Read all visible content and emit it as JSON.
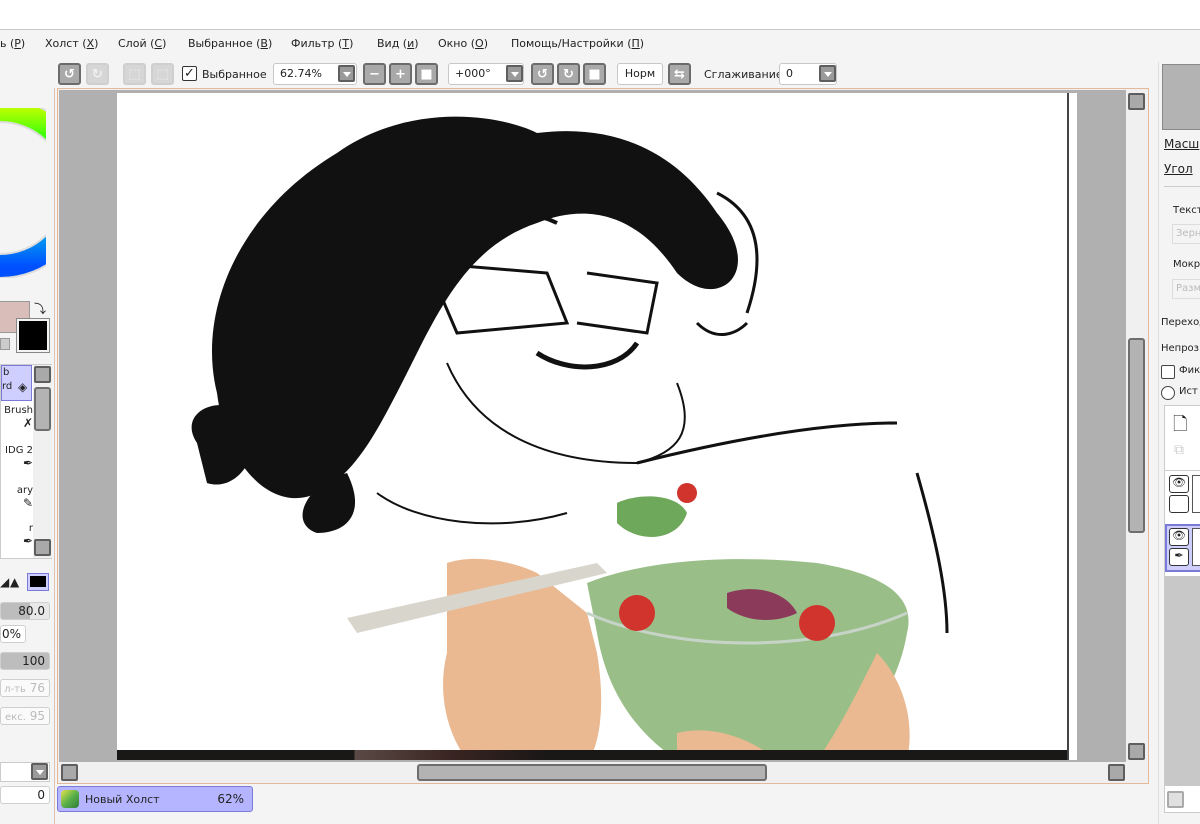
{
  "menu": [
    {
      "label": "ь",
      "key": "Р"
    },
    {
      "label": "Холст",
      "key": "Х"
    },
    {
      "label": "Слой",
      "key": "С"
    },
    {
      "label": "Выбранное",
      "key": "В"
    },
    {
      "label": "Фильтр",
      "key": "Т"
    },
    {
      "label": "Вид",
      "key": "и"
    },
    {
      "label": "Окно",
      "key": "О"
    },
    {
      "label": "Помощь/Настройки",
      "key": "П"
    }
  ],
  "toolbar": {
    "selection_label": "Выбранное",
    "selection_checked": true,
    "zoom_value": "62.74%",
    "rotation_value": "+000°",
    "blend_mode": "Норм",
    "smoothing_label": "Сглаживание",
    "smoothing_value": "0"
  },
  "left_panel": {
    "brushes": [
      {
        "line1": "b",
        "line2": "rd"
      },
      {
        "line1": "Brush",
        "line2": ""
      },
      {
        "line1": "IDG 2",
        "line2": ""
      },
      {
        "line1": "ary",
        "line2": ""
      },
      {
        "line1": "r",
        "line2": ""
      }
    ],
    "size_value": "80.0",
    "size_percent": "0%",
    "density_value": "100",
    "param1_label": "л-ть",
    "param1_value": "76",
    "param2_label": "екс.",
    "param2_value": "95",
    "bottom_value": "0",
    "primary_color": "#d9bdb8",
    "secondary_color": "#000000"
  },
  "right_panel": {
    "scale_label": "Масш",
    "angle_label": "Угол",
    "texture_label": "Текст",
    "texture_field": "Зерн",
    "wet_label": "Мокр",
    "wet_field": "Разм",
    "transition_label": "Переход",
    "opacity_label": "Непроз",
    "fix_label": "Фик",
    "source_label": "Ист"
  },
  "document_tab": {
    "name": "Новый Холст",
    "zoom": "62%"
  }
}
